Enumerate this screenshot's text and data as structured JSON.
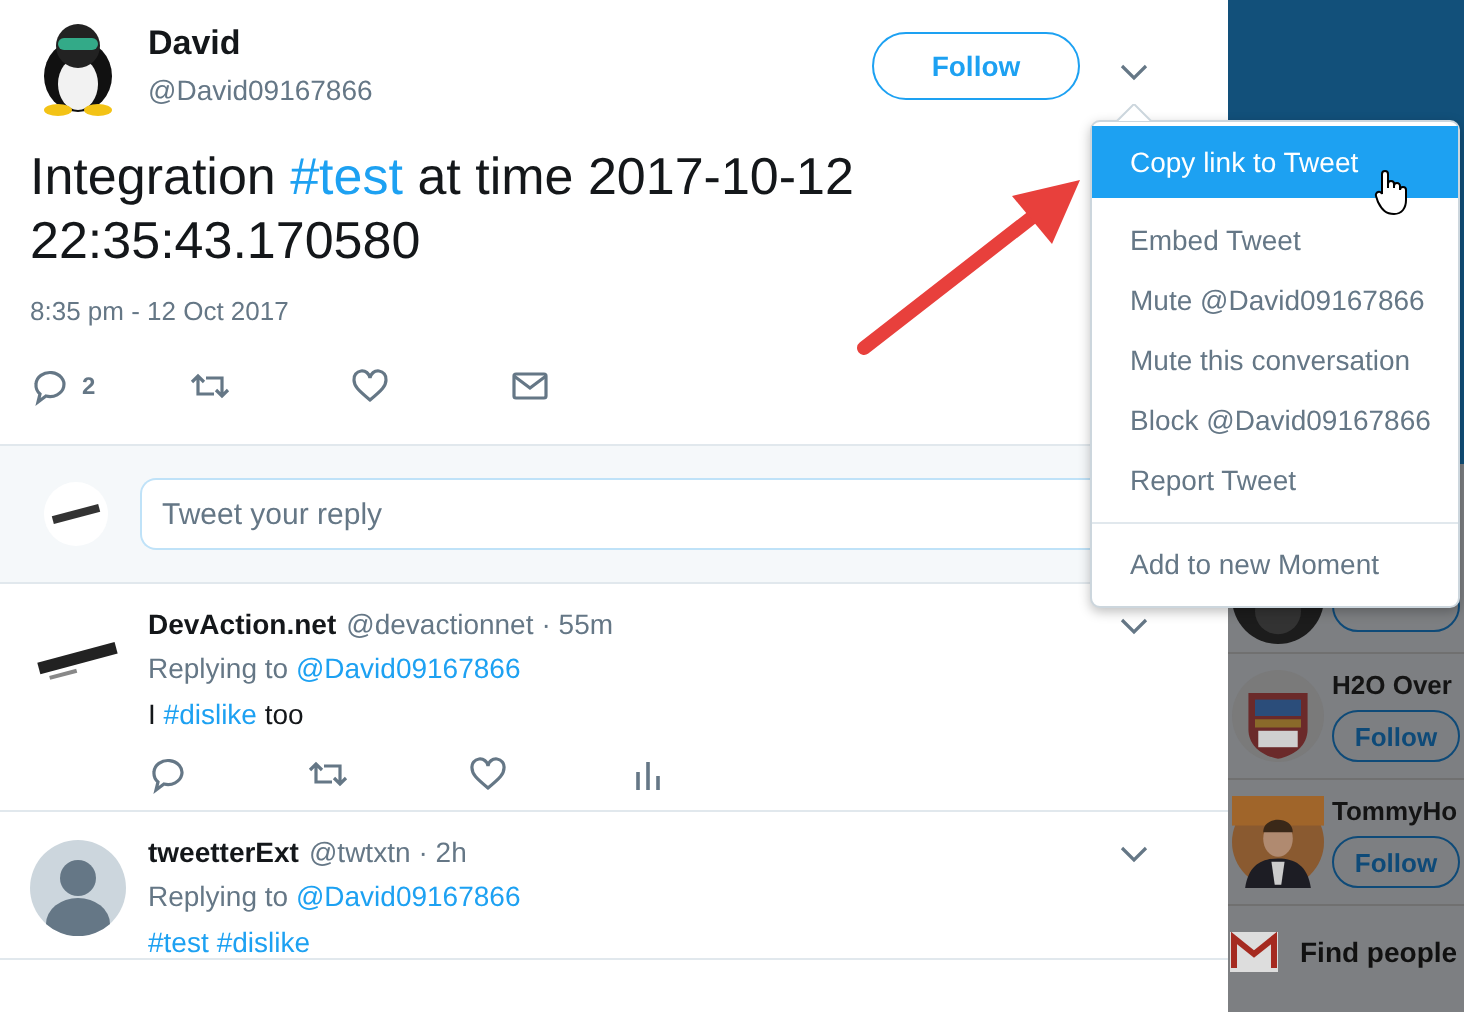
{
  "tweet": {
    "author": {
      "name": "David",
      "handle": "@David09167866"
    },
    "follow_button": "Follow",
    "text": [
      {
        "kind": "plain",
        "text": "Integration "
      },
      {
        "kind": "hashtag",
        "text": "#test"
      },
      {
        "kind": "plain",
        "text": " at time 2017-10-12 22:35:43.170580"
      }
    ],
    "timestamp": "8:35 pm - 12 Oct 2017",
    "actions": [
      {
        "kind": "reply",
        "count": "2"
      },
      {
        "kind": "retweet"
      },
      {
        "kind": "like"
      },
      {
        "kind": "message"
      }
    ]
  },
  "composer": {
    "placeholder": "Tweet your reply"
  },
  "replies": [
    {
      "name": "DevAction.net",
      "handle": "@devactionnet",
      "time": "· 55m",
      "replying": [
        {
          "kind": "plain",
          "text": "Replying to "
        },
        {
          "kind": "mention",
          "text": "@David09167866"
        }
      ],
      "text": [
        {
          "kind": "plain",
          "text": "I "
        },
        {
          "kind": "hashtag",
          "text": "#dislike"
        },
        {
          "kind": "plain",
          "text": " too"
        }
      ],
      "actions": [
        {
          "kind": "reply"
        },
        {
          "kind": "retweet"
        },
        {
          "kind": "like"
        },
        {
          "kind": "stats"
        }
      ]
    },
    {
      "name": "tweetterExt",
      "handle": "@twtxtn",
      "time": "· 2h",
      "replying": [
        {
          "kind": "plain",
          "text": "Replying to "
        },
        {
          "kind": "mention",
          "text": "@David09167866"
        }
      ],
      "text": [
        {
          "kind": "hashtag",
          "text": "#test"
        },
        {
          "kind": "hashtag",
          "text": "#dislike"
        }
      ]
    }
  ],
  "menu": {
    "groups": [
      [
        {
          "label": "Copy link to Tweet",
          "selected": true
        },
        {
          "label": "Embed Tweet",
          "selected": false
        },
        {
          "label": "Mute @David09167866",
          "selected": false
        },
        {
          "label": "Mute this conversation",
          "selected": false
        },
        {
          "label": "Block @David09167866",
          "selected": false
        },
        {
          "label": "Report Tweet",
          "selected": false
        }
      ],
      [
        {
          "label": "Add to new Moment",
          "selected": false
        }
      ]
    ]
  },
  "sidebar": {
    "suggestions": [
      {
        "name": "H2O Over",
        "follow": "Follow"
      },
      {
        "name": "TommyHo",
        "follow": "Follow"
      }
    ],
    "find_people": "Find people"
  }
}
